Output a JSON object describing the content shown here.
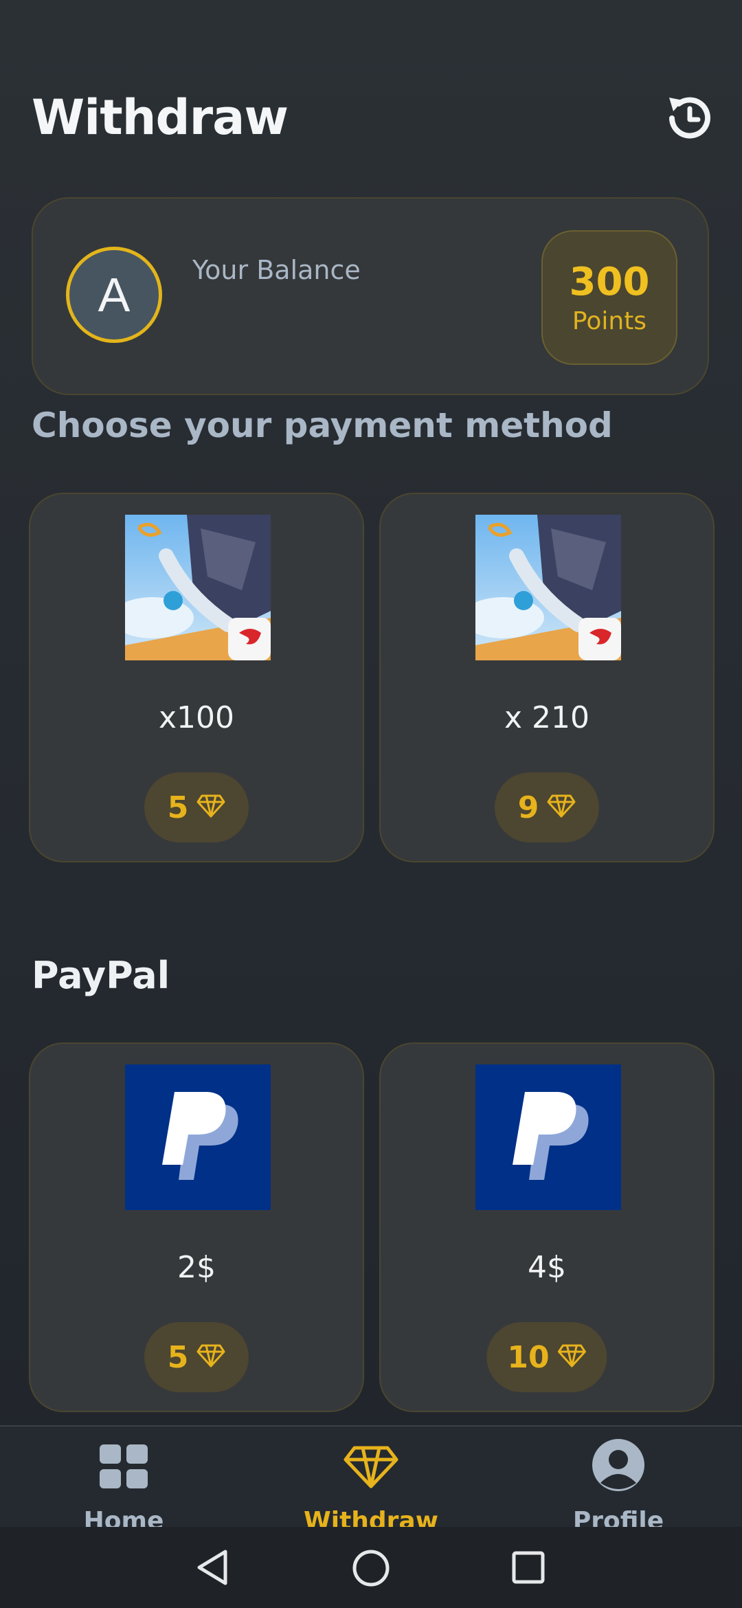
{
  "header": {
    "title": "Withdraw",
    "history_icon": "history-icon"
  },
  "balance": {
    "avatar_letter": "A",
    "label": "Your Balance",
    "points_value": "300",
    "points_unit": "Points"
  },
  "section_heading": "Choose your payment method",
  "freefire_cards": [
    {
      "amount": "x100",
      "cost": "5",
      "icon": "free-fire-game-icon"
    },
    {
      "amount": "x 210",
      "cost": "9",
      "icon": "free-fire-game-icon"
    }
  ],
  "paypal": {
    "heading": "PayPal",
    "cards": [
      {
        "amount": "2$",
        "cost": "5",
        "icon": "paypal-logo-icon"
      },
      {
        "amount": "4$",
        "cost": "10",
        "icon": "paypal-logo-icon"
      }
    ]
  },
  "bottom_nav": {
    "items": [
      {
        "label": "Home",
        "icon": "grid-icon",
        "active": false
      },
      {
        "label": "Withdraw",
        "icon": "diamond-icon",
        "active": true
      },
      {
        "label": "Profile",
        "icon": "user-icon",
        "active": false
      }
    ]
  },
  "colors": {
    "accent": "#e7b31c",
    "background": "#262b31",
    "card": "#36393b",
    "muted_text": "#a9b7c6"
  }
}
